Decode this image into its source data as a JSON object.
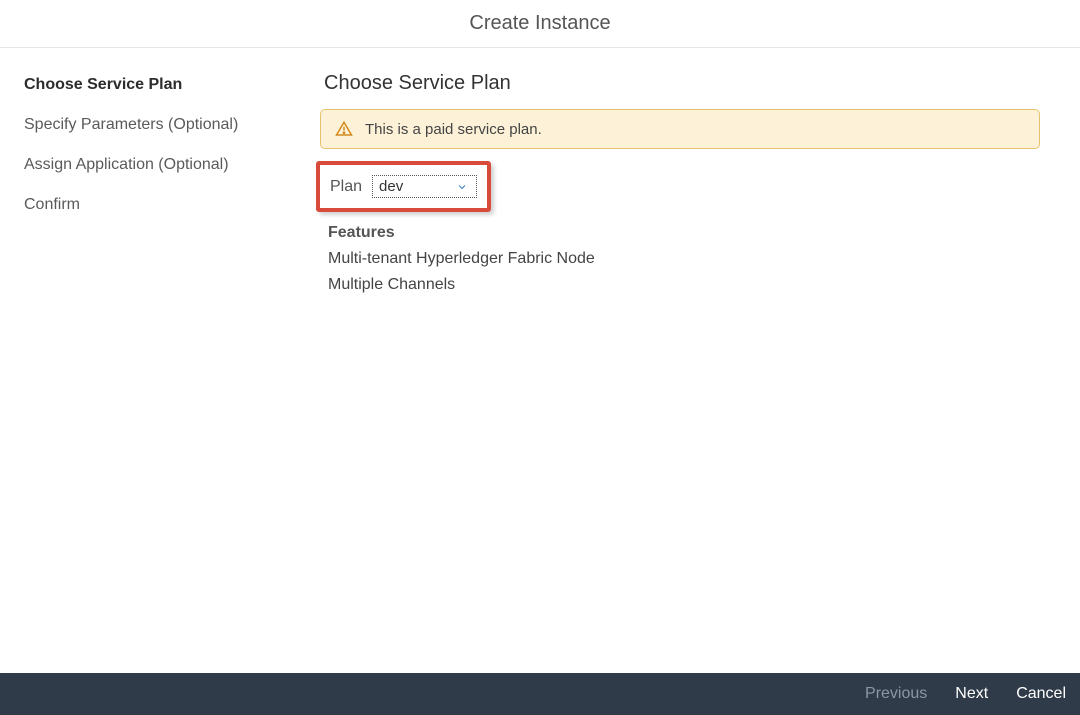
{
  "header": {
    "title": "Create Instance"
  },
  "sidebar": {
    "items": [
      {
        "label": "Choose Service Plan",
        "active": true
      },
      {
        "label": "Specify Parameters (Optional)",
        "active": false
      },
      {
        "label": "Assign Application (Optional)",
        "active": false
      },
      {
        "label": "Confirm",
        "active": false
      }
    ]
  },
  "main": {
    "section_title": "Choose Service Plan",
    "alert_text": "This is a paid service plan.",
    "plan_label": "Plan",
    "plan_selected": "dev",
    "features_heading": "Features",
    "features": [
      "Multi-tenant Hyperledger Fabric Node",
      "Multiple Channels"
    ]
  },
  "footer": {
    "previous": "Previous",
    "next": "Next",
    "cancel": "Cancel"
  }
}
